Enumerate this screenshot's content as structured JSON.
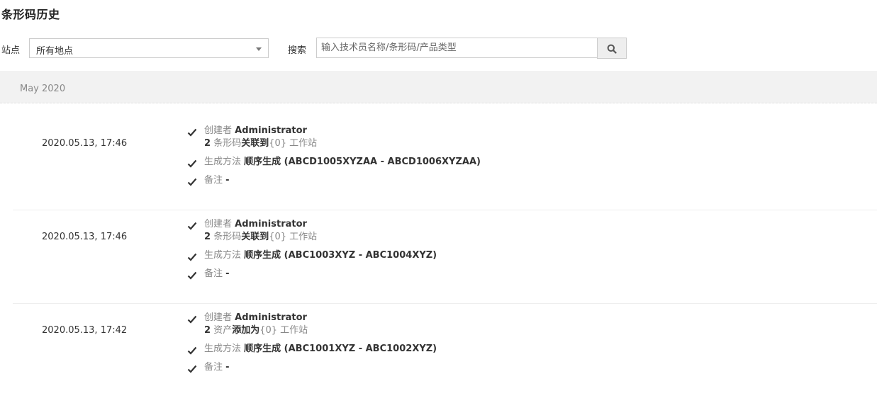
{
  "page": {
    "title": "条形码历史"
  },
  "filters": {
    "site_label": "站点",
    "site_selected": "所有地点",
    "search_label": "搜索",
    "search_placeholder": "输入技术员名称/条形码/产品类型"
  },
  "history": {
    "month": "May 2020",
    "entries": [
      {
        "time": "2020.05.13, 17:46",
        "creator_label": "创建者",
        "creator": "Administrator",
        "count": "2",
        "item_type": "条形码",
        "action": "关联到",
        "target": "{0} 工作站",
        "method_label": "生成方法",
        "method": "顺序生成 (ABCD1005XYZAA - ABCD1006XYZAA)",
        "note_label": "备注",
        "note": "-"
      },
      {
        "time": "2020.05.13, 17:46",
        "creator_label": "创建者",
        "creator": "Administrator",
        "count": "2",
        "item_type": "条形码",
        "action": "关联到",
        "target": "{0} 工作站",
        "method_label": "生成方法",
        "method": "顺序生成 (ABC1003XYZ - ABC1004XYZ)",
        "note_label": "备注",
        "note": "-"
      },
      {
        "time": "2020.05.13, 17:42",
        "creator_label": "创建者",
        "creator": "Administrator",
        "count": "2",
        "item_type": "资产",
        "action": "添加为",
        "target": "{0} 工作站",
        "method_label": "生成方法",
        "method": "顺序生成 (ABC1001XYZ - ABC1002XYZ)",
        "note_label": "备注",
        "note": "-"
      }
    ]
  },
  "icons": {
    "check": "check-icon",
    "search": "search-icon",
    "dropdown": "caret-down-icon"
  }
}
